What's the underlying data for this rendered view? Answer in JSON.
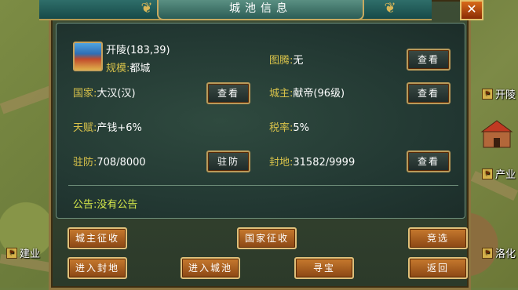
{
  "window": {
    "title": "城池信息",
    "close_label": "✕"
  },
  "city": {
    "name_coords": "开陵(183,39)",
    "scale_label": "规模:",
    "scale_value": "都城",
    "totem_label": "图腾:",
    "totem_value": "无",
    "country_label": "国家:",
    "country_value": "大汉(汉)",
    "lord_label": "城主:",
    "lord_value": "献帝(96级)",
    "talent_label": "天赋:",
    "talent_value": "产钱+6%",
    "tax_label": "税率:",
    "tax_value": "5%",
    "garrison_label": "驻防:",
    "garrison_value": "708/8000",
    "fief_label": "封地:",
    "fief_value": "31582/9999",
    "notice_label": "公告:",
    "notice_value": "没有公告"
  },
  "buttons": {
    "view_totem": "查看",
    "view_country": "查看",
    "view_lord": "查看",
    "garrison": "驻防",
    "view_fief": "查看",
    "lord_levy": "城主征收",
    "country_levy": "国家征收",
    "compete": "竞选",
    "enter_fief": "进入封地",
    "enter_city": "进入城池",
    "treasure": "寻宝",
    "back": "返回"
  },
  "map_labels": {
    "kailing": "开陵",
    "chanye": "产业",
    "jianye": "建业",
    "luohua": "洛化"
  }
}
